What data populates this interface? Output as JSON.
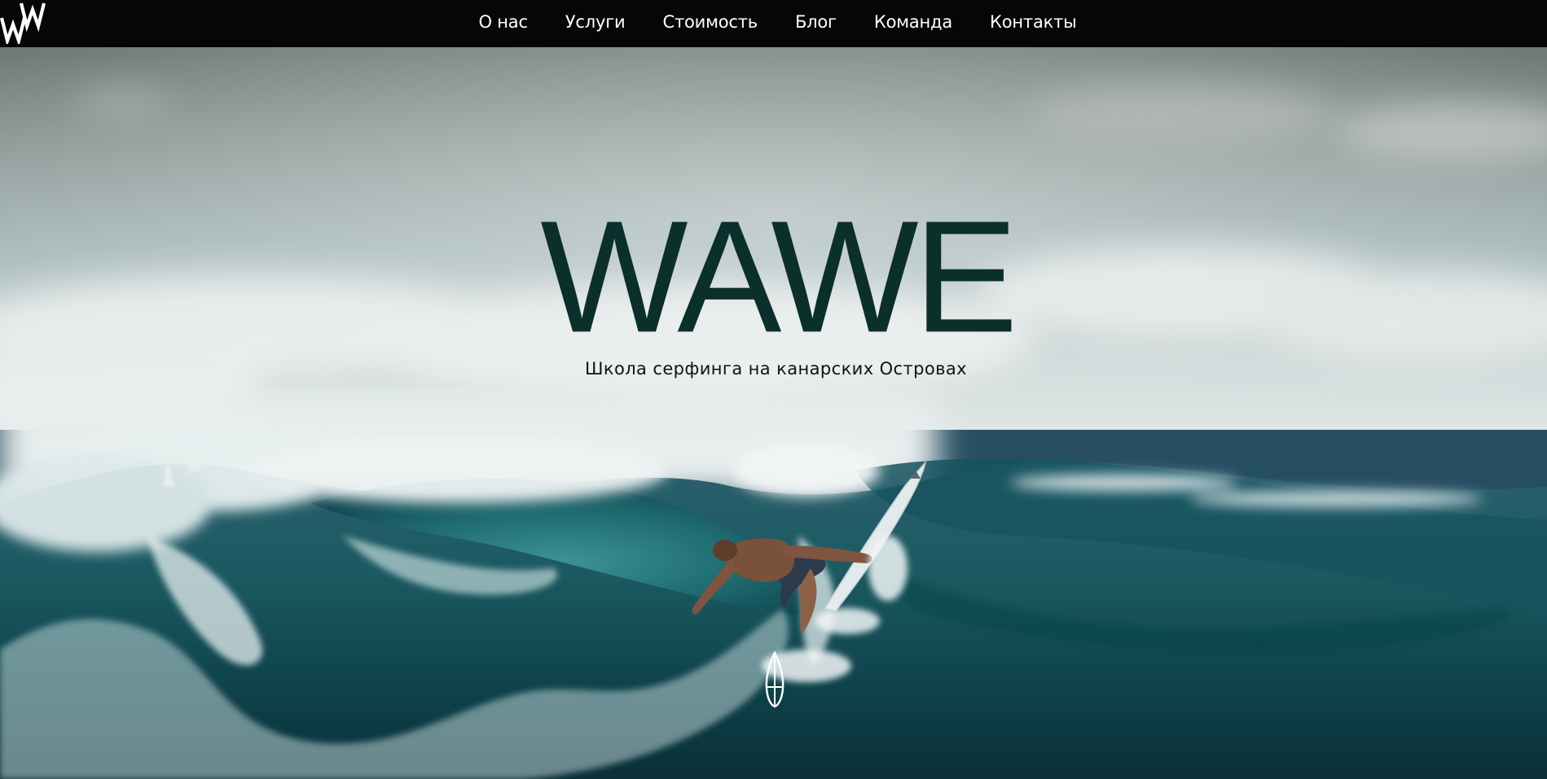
{
  "nav": {
    "items": [
      {
        "id": "about",
        "label": "О нас"
      },
      {
        "id": "services",
        "label": "Услуги"
      },
      {
        "id": "pricing",
        "label": "Стоимость"
      },
      {
        "id": "blog",
        "label": "Блог"
      },
      {
        "id": "team",
        "label": "Команда"
      },
      {
        "id": "contacts",
        "label": "Контакты"
      }
    ],
    "logo_icon": "wawe-logo-icon"
  },
  "hero": {
    "title": "WAWE",
    "subtitle": "Школа серфинга на канарских Островах",
    "scroll_icon": "surfboard-icon"
  },
  "colors": {
    "navbar": "#050607",
    "nav_text": "#ffffff",
    "title": "#0b2f2b",
    "subtitle": "#111111"
  }
}
